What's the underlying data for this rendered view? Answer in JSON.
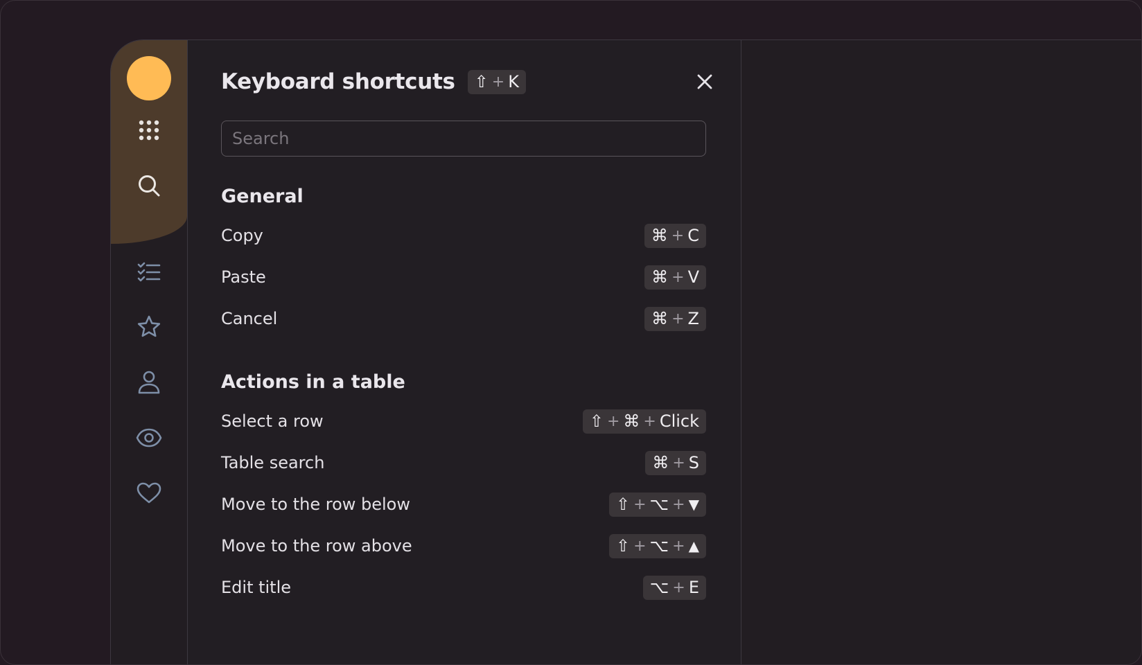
{
  "panel": {
    "title": "Keyboard shortcuts",
    "title_shortcut": [
      "⇧",
      "K"
    ],
    "search_placeholder": "Search"
  },
  "sections": [
    {
      "title": "General",
      "items": [
        {
          "label": "Copy",
          "keys": [
            "⌘",
            "C"
          ]
        },
        {
          "label": "Paste",
          "keys": [
            "⌘",
            "V"
          ]
        },
        {
          "label": "Cancel",
          "keys": [
            "⌘",
            "Z"
          ]
        }
      ]
    },
    {
      "title": "Actions in a table",
      "items": [
        {
          "label": "Select a row",
          "keys": [
            "⇧",
            "⌘",
            "Click"
          ]
        },
        {
          "label": "Table search",
          "keys": [
            "⌘",
            "S"
          ]
        },
        {
          "label": "Move to the row below",
          "keys": [
            "⇧",
            "⌥",
            "▼"
          ]
        },
        {
          "label": "Move to the row above",
          "keys": [
            "⇧",
            "⌥",
            "▲"
          ]
        },
        {
          "label": "Edit title",
          "keys": [
            "⌥",
            "E"
          ]
        }
      ]
    }
  ],
  "sidebar": {
    "items": [
      {
        "icon": "apps-grid-icon"
      },
      {
        "icon": "search-icon"
      },
      {
        "icon": "task-list-icon"
      },
      {
        "icon": "star-icon"
      },
      {
        "icon": "person-icon"
      },
      {
        "icon": "eye-icon"
      },
      {
        "icon": "heart-icon"
      }
    ]
  },
  "colors": {
    "background": "#231a22",
    "panel": "#221e23",
    "sidebar_accent": "#4d3b2b",
    "avatar": "#ffbb55",
    "key_background": "#3a3538",
    "icon": "#7e8fa8"
  }
}
